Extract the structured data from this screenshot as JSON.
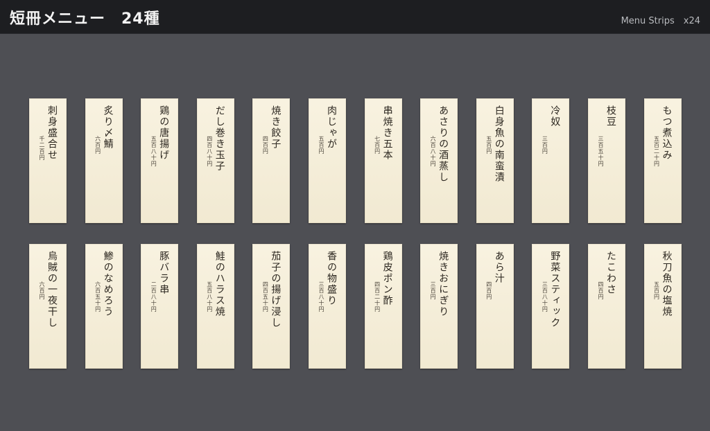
{
  "header": {
    "title": "短冊メニュー　24種",
    "subtitle": "Menu Strips　x24"
  },
  "colors": {
    "header_bg": "#1d1e21",
    "canvas_bg": "#4e4f54",
    "strip_paper": "#f6eed6",
    "strip_ink": "#2c2720"
  },
  "menu": {
    "items": [
      {
        "name": "刺身盛合せ",
        "price": "千二百円"
      },
      {
        "name": "炙り〆鯖",
        "price": "六百円"
      },
      {
        "name": "鶏の唐揚げ",
        "price": "五百八十円"
      },
      {
        "name": "だし巻き玉子",
        "price": "四百八十円"
      },
      {
        "name": "焼き餃子",
        "price": "四百円"
      },
      {
        "name": "肉じゃが",
        "price": "五百円"
      },
      {
        "name": "串焼き五本",
        "price": "七百円"
      },
      {
        "name": "あさりの酒蒸し",
        "price": "六百八十円"
      },
      {
        "name": "白身魚の南蛮漬",
        "price": "五百円"
      },
      {
        "name": "冷奴",
        "price": "三百円"
      },
      {
        "name": "枝豆",
        "price": "三百五十円"
      },
      {
        "name": "もつ煮込み",
        "price": "五百二十円"
      },
      {
        "name": "烏賊の一夜干し",
        "price": "六百円"
      },
      {
        "name": "鯵のなめろう",
        "price": "六百五十円"
      },
      {
        "name": "豚バラ串",
        "price": "二百八十円"
      },
      {
        "name": "鮭のハラス焼",
        "price": "五百八十円"
      },
      {
        "name": "茄子の揚げ浸し",
        "price": "四百五十円"
      },
      {
        "name": "香の物盛り",
        "price": "三百八十円"
      },
      {
        "name": "鶏皮ポン酢",
        "price": "四百二十円"
      },
      {
        "name": "焼きおにぎり",
        "price": "三百円"
      },
      {
        "name": "あら汁",
        "price": "四百円"
      },
      {
        "name": "野菜スティック",
        "price": "三百八十円"
      },
      {
        "name": "たこわさ",
        "price": "四百円"
      },
      {
        "name": "秋刀魚の塩焼",
        "price": "五百円"
      }
    ]
  }
}
